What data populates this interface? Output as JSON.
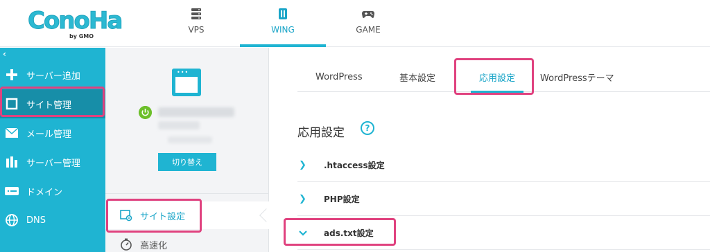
{
  "brand": {
    "logo_text": "ConoHa",
    "logo_sub": "by GMO",
    "accent_color": "#1fb4d2",
    "highlight_color": "#e0427f"
  },
  "services": [
    {
      "label": "VPS",
      "icon": "server-icon"
    },
    {
      "label": "WING",
      "icon": "wing-icon",
      "active": true
    },
    {
      "label": "GAME",
      "icon": "gamepad-icon"
    }
  ],
  "leftnav": {
    "collapse": "‹",
    "items": [
      {
        "label": "サーバー追加",
        "icon": "plus-icon"
      },
      {
        "label": "サイト管理",
        "icon": "window-icon",
        "active": true
      },
      {
        "label": "メール管理",
        "icon": "mail-icon"
      },
      {
        "label": "サーバー管理",
        "icon": "server-manage-icon"
      },
      {
        "label": "ドメイン",
        "icon": "domain-icon"
      },
      {
        "label": "DNS",
        "icon": "globe-icon"
      }
    ]
  },
  "site_panel": {
    "switch_label": "切り替え",
    "menu": [
      {
        "label": "サイト設定",
        "icon": "site-settings-icon",
        "active": true
      },
      {
        "label": "高速化",
        "icon": "stopwatch-icon"
      }
    ]
  },
  "tabs": [
    {
      "label": "WordPress"
    },
    {
      "label": "基本設定"
    },
    {
      "label": "応用設定",
      "active": true
    },
    {
      "label": "WordPressテーマ"
    }
  ],
  "section": {
    "title": "応用設定",
    "help": "?"
  },
  "accordion": [
    {
      "label": ".htaccess設定",
      "expanded": false
    },
    {
      "label": "PHP設定",
      "expanded": false
    },
    {
      "label": "ads.txt設定",
      "expanded": true
    }
  ]
}
